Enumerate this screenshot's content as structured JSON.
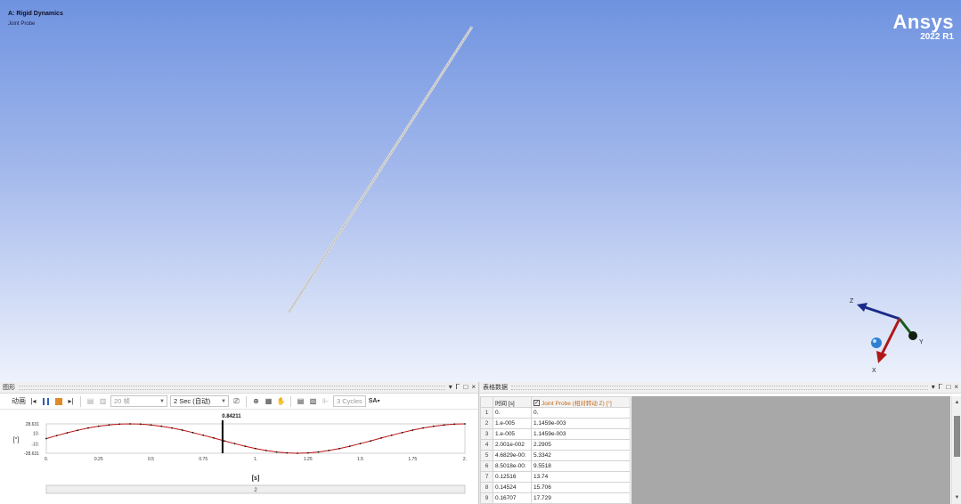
{
  "viewport": {
    "title": "A: Rigid Dynamics",
    "subtitle": "Joint Probe",
    "brand": {
      "name": "Ansys",
      "version": "2022 R1"
    },
    "triad": {
      "axis_z": "Z",
      "axis_y": "Y",
      "axis_x": "X"
    }
  },
  "graph_panel": {
    "title": "图形",
    "controls": {
      "dropdown": "▾",
      "pin": "Ꮁ",
      "maximize": "□",
      "close": "×"
    },
    "toolbar": {
      "animation_label": "动画",
      "frames": "20 帧",
      "speed": "2 Sec (自动)",
      "cycles": "3 Cycles",
      "sa": "SA"
    },
    "y_unit": "[°]",
    "x_unit": "[s]",
    "cursor_value": "0.84211",
    "timeline_label": "2"
  },
  "table_panel": {
    "title": "表格数据",
    "controls": {
      "dropdown": "▾",
      "pin": "Ꮁ",
      "maximize": "□",
      "close": "×"
    },
    "col_time": "时间 [s]",
    "col_probe": "Joint Probe (相对转动 Z) [°]",
    "rows": [
      {
        "n": "1",
        "t": "0.",
        "v": "0."
      },
      {
        "n": "2",
        "t": "1.e-005",
        "v": "1.1459e-003"
      },
      {
        "n": "3",
        "t": "1.e-005",
        "v": "1.1459e-003"
      },
      {
        "n": "4",
        "t": "2.001e-002",
        "v": "2.2905"
      },
      {
        "n": "5",
        "t": "4.6829e-00:",
        "v": "5.3342"
      },
      {
        "n": "6",
        "t": "8.5018e-00:",
        "v": "9.5518"
      },
      {
        "n": "7",
        "t": "0.12516",
        "v": "13.74"
      },
      {
        "n": "8",
        "t": "0.14524",
        "v": "15.706"
      },
      {
        "n": "9",
        "t": "0.16707",
        "v": "17.729"
      }
    ]
  },
  "chart_data": {
    "type": "line",
    "x_ticks": [
      "0.",
      "0.25",
      "0.5",
      "0.75",
      "1.",
      "1.25",
      "1.5",
      "1.75",
      "2."
    ],
    "y_ticks": [
      "28.631",
      "10.",
      "-10.",
      "-28.631"
    ],
    "xlim": [
      0,
      2
    ],
    "ylim": [
      -28.631,
      28.631
    ],
    "xlabel": "[s]",
    "ylabel": "[°]",
    "cursor_x": 0.84211,
    "series": [
      {
        "x": [
          0,
          0.05,
          0.1,
          0.15,
          0.2,
          0.25,
          0.3,
          0.35,
          0.4,
          0.45,
          0.5,
          0.55,
          0.6,
          0.65,
          0.7,
          0.75,
          0.8,
          0.85,
          0.9,
          0.95,
          1.0,
          1.05,
          1.1,
          1.15,
          1.2,
          1.25,
          1.3,
          1.35,
          1.4,
          1.45,
          1.5,
          1.55,
          1.6,
          1.65,
          1.7,
          1.75,
          1.8,
          1.85,
          1.9,
          1.95,
          2.0
        ],
        "y": [
          0,
          5.7,
          11.2,
          16.2,
          20.6,
          24.1,
          26.6,
          28.2,
          28.6,
          28.1,
          26.5,
          24.0,
          20.6,
          16.4,
          11.6,
          6.4,
          1.0,
          -4.5,
          -9.9,
          -15.0,
          -19.5,
          -23.3,
          -26.2,
          -28.0,
          -28.6,
          -28.0,
          -26.2,
          -23.3,
          -19.5,
          -15.0,
          -9.9,
          -4.5,
          1.0,
          6.4,
          11.6,
          16.4,
          20.6,
          24.0,
          26.5,
          28.1,
          28.6
        ]
      }
    ]
  }
}
